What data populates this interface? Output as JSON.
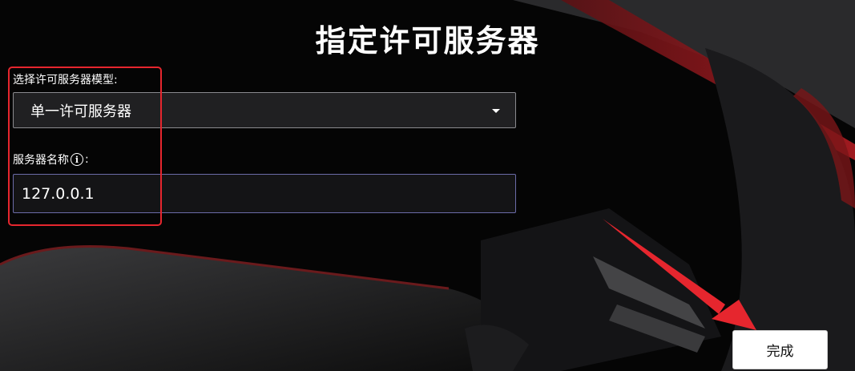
{
  "page": {
    "title": "指定许可服务器"
  },
  "form": {
    "model_label": "选择许可服务器模型:",
    "model_selected": "单一许可服务器",
    "server_label": "服务器名称",
    "server_label_suffix": ":",
    "info_glyph": "i",
    "server_value": "127.0.0.1"
  },
  "actions": {
    "done_label": "完成"
  },
  "annotations": {
    "highlight_color": "#e6262e",
    "arrow_color": "#e6262e"
  },
  "icons": {
    "dropdown": "caret-down-icon",
    "info": "info-icon"
  }
}
